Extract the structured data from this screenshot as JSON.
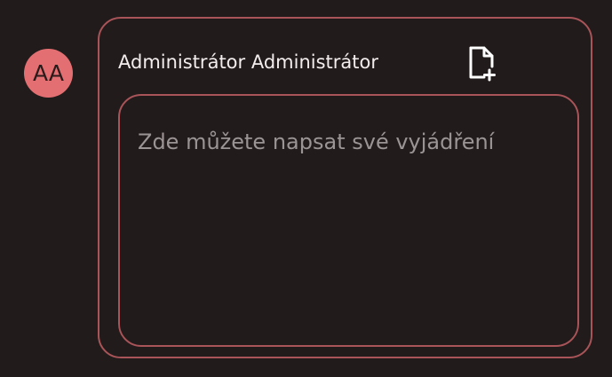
{
  "avatar": {
    "initials": "AA",
    "color": "#e46f72"
  },
  "comment_form": {
    "author_name": "Administrátor Administrátor",
    "attach_icon": "file-plus-icon",
    "textarea": {
      "value": "",
      "placeholder": "Zde můžete napsat své vyjádření"
    }
  },
  "colors": {
    "background": "#221b1b",
    "border": "#a85458",
    "text": "#f3eded",
    "placeholder": "#9b9494"
  }
}
